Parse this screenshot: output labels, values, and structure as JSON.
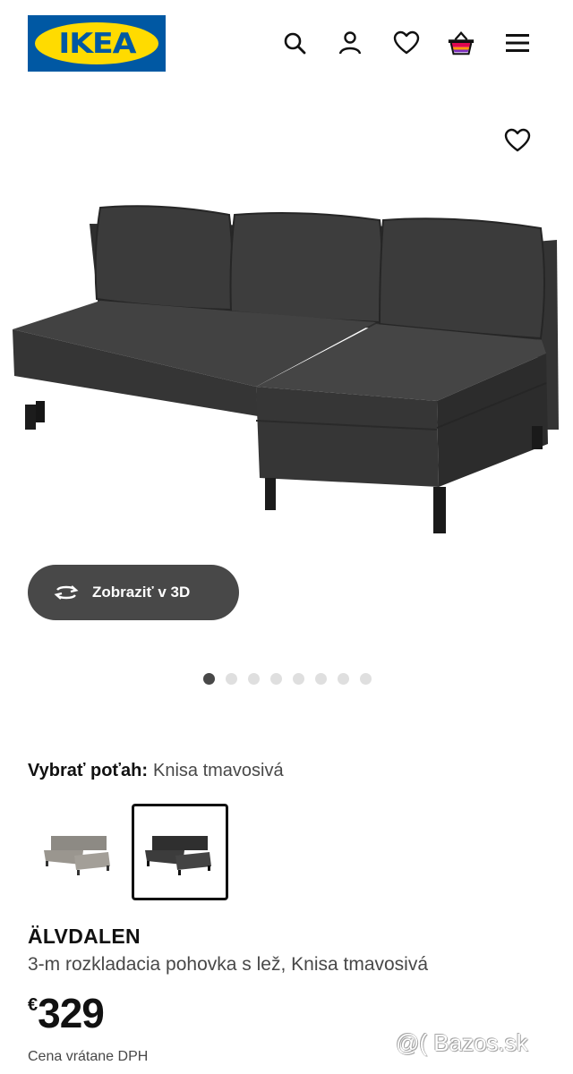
{
  "header": {
    "logo_text": "IKEA",
    "icons": [
      "search-icon",
      "user-icon",
      "heart-icon",
      "basket-icon",
      "menu-icon"
    ]
  },
  "gallery": {
    "view3d_label": "Zobraziť v 3D",
    "image_count": 8,
    "active_index": 0
  },
  "color_picker": {
    "label": "Vybrať poťah:",
    "selected_value": "Knisa tmavosivá",
    "options": [
      "light-gray-variant",
      "dark-gray-variant"
    ],
    "selected_index": 1
  },
  "product": {
    "name": "ÄLVDALEN",
    "description": "3-m rozkladacia pohovka s lež, Knisa tmavosivá",
    "currency": "€",
    "price": "329",
    "vat_note": "Cena vrátane DPH"
  },
  "watermark": "@( Bazos.sk",
  "colors": {
    "brand_blue": "#0058a3",
    "brand_yellow": "#ffdb00",
    "button_dark": "#484848",
    "sofa_dark": "#3a3a3a"
  }
}
